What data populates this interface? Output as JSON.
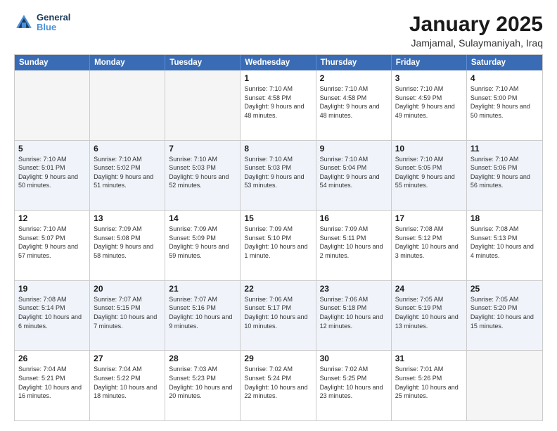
{
  "logo": {
    "line1": "General",
    "line2": "Blue"
  },
  "header": {
    "title": "January 2025",
    "location": "Jamjamal, Sulaymaniyah, Iraq"
  },
  "days_of_week": [
    "Sunday",
    "Monday",
    "Tuesday",
    "Wednesday",
    "Thursday",
    "Friday",
    "Saturday"
  ],
  "weeks": [
    [
      {
        "day": "",
        "info": "",
        "empty": true
      },
      {
        "day": "",
        "info": "",
        "empty": true
      },
      {
        "day": "",
        "info": "",
        "empty": true
      },
      {
        "day": "1",
        "info": "Sunrise: 7:10 AM\nSunset: 4:58 PM\nDaylight: 9 hours and 48 minutes.",
        "empty": false
      },
      {
        "day": "2",
        "info": "Sunrise: 7:10 AM\nSunset: 4:58 PM\nDaylight: 9 hours and 48 minutes.",
        "empty": false
      },
      {
        "day": "3",
        "info": "Sunrise: 7:10 AM\nSunset: 4:59 PM\nDaylight: 9 hours and 49 minutes.",
        "empty": false
      },
      {
        "day": "4",
        "info": "Sunrise: 7:10 AM\nSunset: 5:00 PM\nDaylight: 9 hours and 50 minutes.",
        "empty": false
      }
    ],
    [
      {
        "day": "5",
        "info": "Sunrise: 7:10 AM\nSunset: 5:01 PM\nDaylight: 9 hours and 50 minutes.",
        "empty": false
      },
      {
        "day": "6",
        "info": "Sunrise: 7:10 AM\nSunset: 5:02 PM\nDaylight: 9 hours and 51 minutes.",
        "empty": false
      },
      {
        "day": "7",
        "info": "Sunrise: 7:10 AM\nSunset: 5:03 PM\nDaylight: 9 hours and 52 minutes.",
        "empty": false
      },
      {
        "day": "8",
        "info": "Sunrise: 7:10 AM\nSunset: 5:03 PM\nDaylight: 9 hours and 53 minutes.",
        "empty": false
      },
      {
        "day": "9",
        "info": "Sunrise: 7:10 AM\nSunset: 5:04 PM\nDaylight: 9 hours and 54 minutes.",
        "empty": false
      },
      {
        "day": "10",
        "info": "Sunrise: 7:10 AM\nSunset: 5:05 PM\nDaylight: 9 hours and 55 minutes.",
        "empty": false
      },
      {
        "day": "11",
        "info": "Sunrise: 7:10 AM\nSunset: 5:06 PM\nDaylight: 9 hours and 56 minutes.",
        "empty": false
      }
    ],
    [
      {
        "day": "12",
        "info": "Sunrise: 7:10 AM\nSunset: 5:07 PM\nDaylight: 9 hours and 57 minutes.",
        "empty": false
      },
      {
        "day": "13",
        "info": "Sunrise: 7:09 AM\nSunset: 5:08 PM\nDaylight: 9 hours and 58 minutes.",
        "empty": false
      },
      {
        "day": "14",
        "info": "Sunrise: 7:09 AM\nSunset: 5:09 PM\nDaylight: 9 hours and 59 minutes.",
        "empty": false
      },
      {
        "day": "15",
        "info": "Sunrise: 7:09 AM\nSunset: 5:10 PM\nDaylight: 10 hours and 1 minute.",
        "empty": false
      },
      {
        "day": "16",
        "info": "Sunrise: 7:09 AM\nSunset: 5:11 PM\nDaylight: 10 hours and 2 minutes.",
        "empty": false
      },
      {
        "day": "17",
        "info": "Sunrise: 7:08 AM\nSunset: 5:12 PM\nDaylight: 10 hours and 3 minutes.",
        "empty": false
      },
      {
        "day": "18",
        "info": "Sunrise: 7:08 AM\nSunset: 5:13 PM\nDaylight: 10 hours and 4 minutes.",
        "empty": false
      }
    ],
    [
      {
        "day": "19",
        "info": "Sunrise: 7:08 AM\nSunset: 5:14 PM\nDaylight: 10 hours and 6 minutes.",
        "empty": false
      },
      {
        "day": "20",
        "info": "Sunrise: 7:07 AM\nSunset: 5:15 PM\nDaylight: 10 hours and 7 minutes.",
        "empty": false
      },
      {
        "day": "21",
        "info": "Sunrise: 7:07 AM\nSunset: 5:16 PM\nDaylight: 10 hours and 9 minutes.",
        "empty": false
      },
      {
        "day": "22",
        "info": "Sunrise: 7:06 AM\nSunset: 5:17 PM\nDaylight: 10 hours and 10 minutes.",
        "empty": false
      },
      {
        "day": "23",
        "info": "Sunrise: 7:06 AM\nSunset: 5:18 PM\nDaylight: 10 hours and 12 minutes.",
        "empty": false
      },
      {
        "day": "24",
        "info": "Sunrise: 7:05 AM\nSunset: 5:19 PM\nDaylight: 10 hours and 13 minutes.",
        "empty": false
      },
      {
        "day": "25",
        "info": "Sunrise: 7:05 AM\nSunset: 5:20 PM\nDaylight: 10 hours and 15 minutes.",
        "empty": false
      }
    ],
    [
      {
        "day": "26",
        "info": "Sunrise: 7:04 AM\nSunset: 5:21 PM\nDaylight: 10 hours and 16 minutes.",
        "empty": false
      },
      {
        "day": "27",
        "info": "Sunrise: 7:04 AM\nSunset: 5:22 PM\nDaylight: 10 hours and 18 minutes.",
        "empty": false
      },
      {
        "day": "28",
        "info": "Sunrise: 7:03 AM\nSunset: 5:23 PM\nDaylight: 10 hours and 20 minutes.",
        "empty": false
      },
      {
        "day": "29",
        "info": "Sunrise: 7:02 AM\nSunset: 5:24 PM\nDaylight: 10 hours and 22 minutes.",
        "empty": false
      },
      {
        "day": "30",
        "info": "Sunrise: 7:02 AM\nSunset: 5:25 PM\nDaylight: 10 hours and 23 minutes.",
        "empty": false
      },
      {
        "day": "31",
        "info": "Sunrise: 7:01 AM\nSunset: 5:26 PM\nDaylight: 10 hours and 25 minutes.",
        "empty": false
      },
      {
        "day": "",
        "info": "",
        "empty": true
      }
    ]
  ]
}
